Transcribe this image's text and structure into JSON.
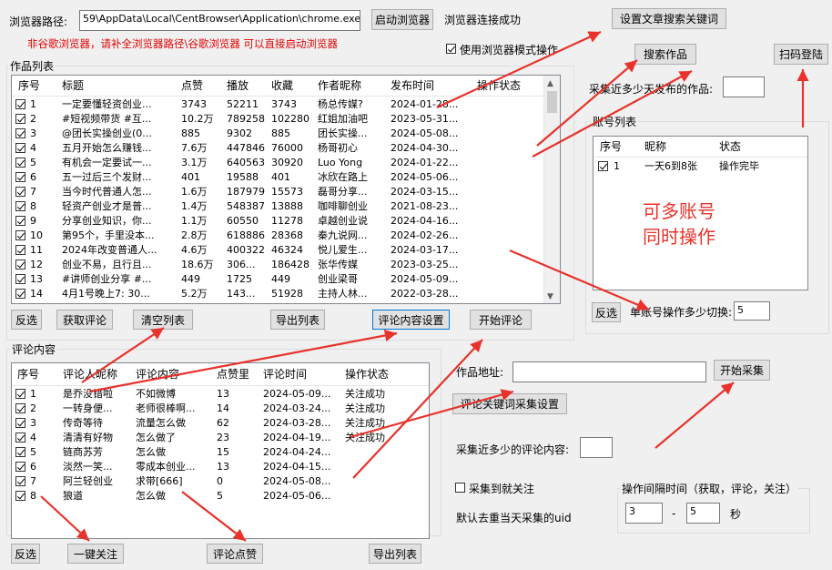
{
  "top": {
    "browser_path_label": "浏览器路径:",
    "browser_path_value": "59\\AppData\\Local\\CentBrowser\\Application\\chrome.exe",
    "launch_button": "启动浏览器",
    "status_text": "浏览器连接成功",
    "set_keyword_button": "设置文章搜索关键词",
    "hint_text": "非谷歌浏览器，请补全浏览器路径\\谷歌浏览器 可以直接启动浏览器",
    "browser_mode_checkbox": "使用浏览器模式操作",
    "search_button": "搜索作品",
    "scan_login_button": "扫码登陆",
    "days_label": "采集近多少天发布的作品:",
    "days_value": ""
  },
  "works": {
    "group_title": "作品列表",
    "columns": [
      "序号",
      "标题",
      "点赞",
      "播放",
      "收藏",
      "作者昵称",
      "发布时间",
      "操作状态"
    ],
    "rows": [
      [
        "1",
        "一定要懂轻资创业...",
        "3743",
        "52211",
        "3743",
        "杨总传媒?",
        "2024-01-28...",
        ""
      ],
      [
        "2",
        "#短视频带货 #互...",
        "10.2万",
        "789258",
        "102280",
        "红姐加油吧",
        "2023-05-31...",
        ""
      ],
      [
        "3",
        "@团长实操创业(0...",
        "885",
        "9302",
        "885",
        "团长实操...",
        "2024-05-08...",
        ""
      ],
      [
        "4",
        "五月开始怎么赚钱...",
        "7.6万",
        "447846",
        "76000",
        "杨哥初心",
        "2024-04-30...",
        ""
      ],
      [
        "5",
        "有机会一定要试一...",
        "3.1万",
        "640563",
        "30920",
        "Luo Yong",
        "2024-01-22...",
        ""
      ],
      [
        "6",
        "五一过后三个发财...",
        "401",
        "19588",
        "401",
        "冰欣在路上",
        "2024-05-06...",
        ""
      ],
      [
        "7",
        "当今时代普通人怎...",
        "1.6万",
        "187979",
        "15573",
        "磊哥分享...",
        "2024-03-15...",
        ""
      ],
      [
        "8",
        "轻资产创业才是普...",
        "1.4万",
        "548387",
        "13888",
        "咖啡聊创业",
        "2021-08-23...",
        ""
      ],
      [
        "9",
        "分享创业知识，你...",
        "1.1万",
        "60550",
        "11278",
        "卓越创业说",
        "2024-04-16...",
        ""
      ],
      [
        "10",
        "第95个，手里没本...",
        "2.8万",
        "618886",
        "28368",
        "秦九说网...",
        "2024-02-26...",
        ""
      ],
      [
        "11",
        "2024年改变普通人...",
        "4.6万",
        "400322",
        "46324",
        "悦儿爱生...",
        "2024-03-17...",
        ""
      ],
      [
        "12",
        "创业不易，且行且...",
        "18.6万",
        "306...",
        "186428",
        "张华传媒",
        "2023-03-25...",
        ""
      ],
      [
        "13",
        "#讲师创业分享 #...",
        "449",
        "1725",
        "449",
        "创业梁哥",
        "2024-05-09...",
        ""
      ],
      [
        "14",
        "4月1号晚上7: 30...",
        "5.2万",
        "143...",
        "51928",
        "主持人林...",
        "2022-03-28...",
        ""
      ]
    ],
    "buttons": {
      "invert": "反选",
      "get_comments": "获取评论",
      "clear_list": "清空列表",
      "export_list": "导出列表",
      "comment_settings": "评论内容设置",
      "start_comment": "开始评论"
    }
  },
  "accounts": {
    "group_title": "账号列表",
    "columns": [
      "序号",
      "昵称",
      "状态"
    ],
    "rows": [
      [
        "1",
        "一天6到8张",
        "操作完毕"
      ]
    ],
    "overlay_text_1": "可多账号",
    "overlay_text_2": "同时操作",
    "invert": "反选",
    "switch_label": "单账号操作多少切换:",
    "switch_value": "5"
  },
  "comments": {
    "group_title": "评论内容",
    "columns": [
      "序号",
      "评论人昵称",
      "评论内容",
      "点赞里",
      "评论时间",
      "操作状态"
    ],
    "rows": [
      [
        "1",
        "是乔没错啦",
        "不如微博",
        "13",
        "2024-05-09...",
        "关注成功"
      ],
      [
        "2",
        "一转身便...",
        "老师很棒啊...",
        "14",
        "2024-03-24...",
        "关注成功"
      ],
      [
        "3",
        "传奇等待",
        "流量怎么做",
        "62",
        "2024-03-28...",
        "关注成功"
      ],
      [
        "4",
        "清清有好物",
        "怎么做了",
        "23",
        "2024-04-19...",
        "关注成功"
      ],
      [
        "5",
        "链商苏芳",
        "怎么做",
        "15",
        "2024-04-24...",
        ""
      ],
      [
        "6",
        "淡然一笑...",
        "零成本创业...",
        "13",
        "2024-04-15...",
        ""
      ],
      [
        "7",
        "阿兰轻创业",
        "求带[666]",
        "0",
        "2024-05-08...",
        ""
      ],
      [
        "8",
        "狼道",
        "怎么做",
        "5",
        "2024-05-06...",
        ""
      ]
    ],
    "buttons": {
      "invert": "反选",
      "follow_all": "一键关注",
      "like_comment": "评论点赞",
      "export_list": "导出列表"
    }
  },
  "collect": {
    "url_label": "作品地址:",
    "url_value": "",
    "start_collect": "开始采集",
    "keyword_settings": "评论关键词采集设置",
    "count_label": "采集近多少的评论内容:",
    "count_value": "",
    "follow_checkbox": "采集到就关注",
    "dedupe_text": "默认去重当天采集的uid",
    "interval_title": "操作间隔时间（获取，评论，关注）",
    "interval_min": "3",
    "interval_dash": "-",
    "interval_max": "5",
    "interval_unit": "秒"
  },
  "colors": {
    "annotation_red": "#e8322b",
    "focus_blue": "#0078d7"
  }
}
